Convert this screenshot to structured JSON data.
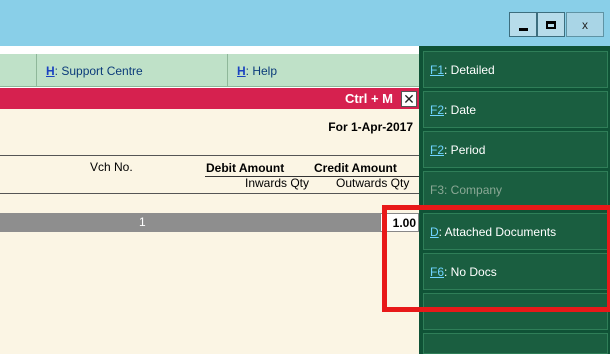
{
  "window": {
    "minimize_label": "_",
    "maximize_label": "□",
    "close_label": "x"
  },
  "menu": {
    "support": {
      "hotkey": "H",
      "label": ": Support Centre"
    },
    "help": {
      "hotkey": "H",
      "label": ": Help"
    }
  },
  "report": {
    "shortcut": "Ctrl + M",
    "close_glyph": "✕",
    "period": "For 1-Apr-2017",
    "columns": {
      "vch_no": "Vch No.",
      "debit": "Debit Amount",
      "credit": "Credit Amount",
      "inwards": "Inwards Qty",
      "outwards": "Outwards Qty"
    },
    "rows": [
      {
        "vch_no": "1",
        "amount": "1.00"
      }
    ]
  },
  "side_buttons": [
    {
      "hotkey": "F1",
      "label": ": Detailed",
      "enabled": true
    },
    {
      "hotkey": "F2",
      "label": ": Date",
      "enabled": true
    },
    {
      "hotkey": "F2",
      "label": ": Period",
      "enabled": true
    },
    {
      "hotkey": "F3",
      "label": ": Company",
      "enabled": false
    },
    {
      "hotkey": "D",
      "label": ": Attached Documents",
      "enabled": true
    },
    {
      "hotkey": "F6",
      "label": ": No Docs",
      "enabled": true
    },
    {
      "hotkey": "",
      "label": "",
      "enabled": true
    },
    {
      "hotkey": "",
      "label": "",
      "enabled": true
    }
  ],
  "colors": {
    "titlebar": "#89cfe8",
    "menustrip": "#bfe1c8",
    "redbar": "#d6214f",
    "content_bg": "#fbf5e4",
    "side_panel": "#0f5236",
    "highlight": "#e81919"
  }
}
